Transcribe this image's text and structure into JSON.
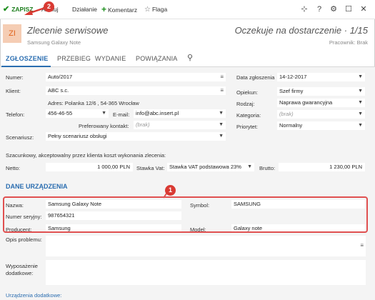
{
  "toolbar": {
    "save_label": "ZAPISZ",
    "cancel_label": "Anuluj",
    "action_label": "Działanie",
    "comment_label": "Komentarz",
    "flag_label": "Flaga",
    "badge_save": "2"
  },
  "header": {
    "avatar": "ZI",
    "title": "Zlecenie serwisowe",
    "subtitle": "Samsung Galaxy Note",
    "status": "Oczekuje na dostarczenie · 1/15",
    "worker": "Pracownik: Brak"
  },
  "tabs": [
    "ZGŁOSZENIE",
    "PRZEBIEG",
    "WYDANIE",
    "POWIĄZANIA"
  ],
  "form": {
    "numer_label": "Numer:",
    "numer_value": "Auto/2017",
    "klient_label": "Klient:",
    "klient_value": "ABC s.c.",
    "adres_value": "Adres: Polanka 12/6 , 54-365 Wrocław",
    "telefon_label": "Telefon:",
    "telefon_value": "456-46-55",
    "email_label": "E-mail:",
    "email_value": "info@abc.insert.pl",
    "pref_label": "Preferowany kontakt:",
    "pref_value": "(brak)",
    "scenariusz_label": "Scenariusz:",
    "scenariusz_value": "Pełny scenariusz obsługi",
    "data_label": "Data zgłoszenia",
    "data_value": "14-12-2017",
    "opiekun_label": "Opiekun:",
    "opiekun_value": "Szef firmy",
    "rodzaj_label": "Rodzaj:",
    "rodzaj_value": "Naprawa gwarancyjna",
    "kategoria_label": "Kategoria:",
    "kategoria_value": "(brak)",
    "priorytet_label": "Priorytet:",
    "priorytet_value": "Normalny",
    "koszt_note": "Szacunkowy, akceptowalny przez klienta koszt wykonania zlecenia:",
    "netto_label": "Netto:",
    "netto_value": "1 000,00 PLN",
    "stawka_label": "Stawka Vat:",
    "stawka_value": "Stawka VAT podstawowa 23%",
    "brutto_label": "Brutto:",
    "brutto_value": "1 230,00 PLN"
  },
  "device": {
    "section_title": "DANE URZĄDZENIA",
    "badge": "1",
    "nazwa_label": "Nazwa:",
    "nazwa_value": "Samsung Galaxy Note",
    "symbol_label": "Symbol:",
    "symbol_value": "SAMSUNG",
    "numer_label": "Numer seryjny:",
    "numer_value": "987654321",
    "producent_label": "Producent:",
    "producent_value": "Samsung",
    "model_label": "Model:",
    "model_value": "Galaxy note"
  },
  "extra": {
    "opis_label": "Opis problemu:",
    "wyposazenie_label": "Wyposażenie dodatkowe:",
    "urzadzenia_label": "Urządzenia dodatkowe:"
  },
  "colors": {
    "accent": "#2a6db0",
    "save_green": "#1e7f1e",
    "highlight_red": "#e05050"
  }
}
